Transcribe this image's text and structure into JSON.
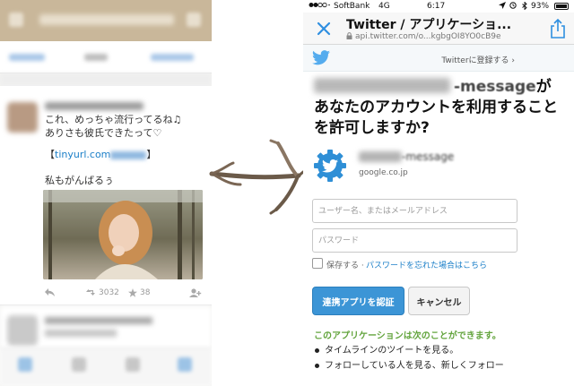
{
  "left_panel": {
    "tweet_lines": [
      "これ、めっちゃ流行ってるね♫",
      "ありさも彼氏できたって♡"
    ],
    "link_text": "tinyurl.com",
    "line3": "私もがんばるぅ",
    "retweet_count": "3032",
    "favorite_count": "38",
    "icons": [
      "reply-icon",
      "retweet-icon",
      "star-icon",
      "follow-icon"
    ]
  },
  "status_bar": {
    "carrier": "SoftBank",
    "network": "4G",
    "time": "6:17",
    "battery": "93%"
  },
  "nav": {
    "title": "Twitter / アプリケーショ...",
    "url": "api.twitter.com/o...kgbgOI8YO0cB9e"
  },
  "topbar": {
    "signup": "Twitterに登録する ›"
  },
  "question": {
    "suffix": "があなたのアカウントを利用することを許可しますか?",
    "name_suffix": "-message"
  },
  "app": {
    "name_suffix": "-message",
    "domain": "google.co.jp"
  },
  "form": {
    "username_placeholder": "ユーザー名、またはメールアドレス",
    "password_placeholder": "パスワード",
    "remember_label": "保存する ·",
    "forgot_link": "パスワードを忘れた場合はこちら"
  },
  "buttons": {
    "authorize": "連携アプリを認証",
    "cancel": "キャンセル"
  },
  "permissions": {
    "heading": "このアプリケーションは次のことができます。",
    "items": [
      "タイムラインのツイートを見る。",
      "フォローしている人を見る、新しくフォロー"
    ]
  },
  "colors": {
    "twitter_blue": "#55acee",
    "link_blue": "#1b7fc8",
    "authorize_blue": "#3c95d6",
    "permission_green": "#63a43d"
  }
}
